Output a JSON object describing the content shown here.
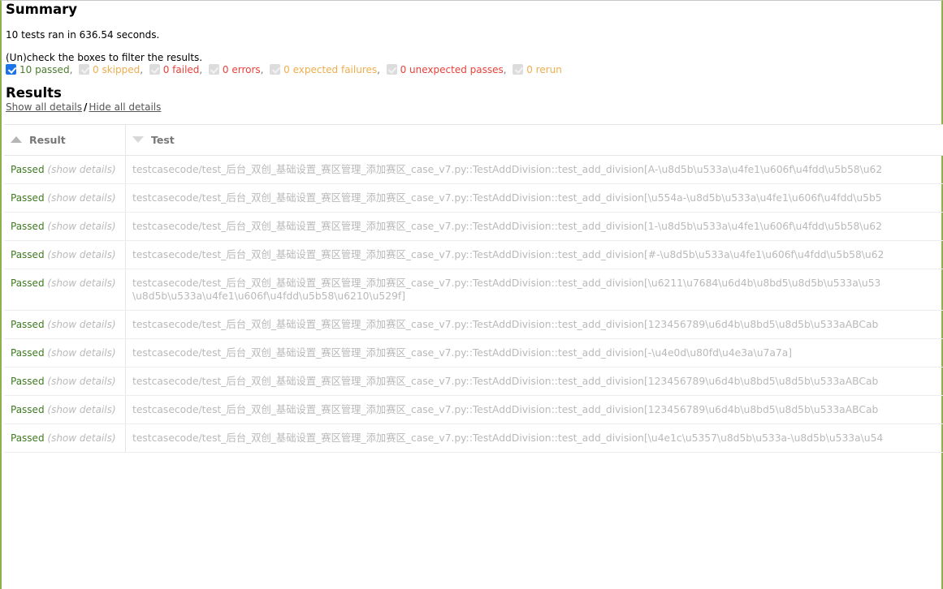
{
  "summary": {
    "title": "Summary",
    "run_line": "10 tests ran in 636.54 seconds.",
    "filter_hint": "(Un)check the boxes to filter the results.",
    "filters": [
      {
        "label": "10 passed",
        "checked": true,
        "color": "#4a7d2c",
        "name": "passed"
      },
      {
        "label": "0 skipped",
        "checked": false,
        "color": "#f0ad4e",
        "name": "skipped"
      },
      {
        "label": "0 failed",
        "checked": false,
        "color": "#e8413a",
        "name": "failed"
      },
      {
        "label": "0 errors",
        "checked": false,
        "color": "#e8413a",
        "name": "errors"
      },
      {
        "label": "0 expected failures",
        "checked": false,
        "color": "#f0ad4e",
        "name": "expected-failures"
      },
      {
        "label": "0 unexpected passes",
        "checked": false,
        "color": "#e8413a",
        "name": "unexpected-passes"
      },
      {
        "label": "0 rerun",
        "checked": false,
        "color": "#f0ad4e",
        "name": "rerun"
      }
    ],
    "separator": ","
  },
  "results": {
    "title": "Results",
    "show_all": "Show all details",
    "separator": "/",
    "hide_all": "Hide all details",
    "columns": [
      {
        "label": "Result",
        "sort": "asc"
      },
      {
        "label": "Test",
        "sort": "desc"
      }
    ],
    "rows": [
      {
        "result": "Passed",
        "detail_link": "(show details)",
        "test": "testcasecode/test_后台_双创_基础设置_赛区管理_添加赛区_case_v7.py::TestAddDivision::test_add_division[A-\\u8d5b\\u533a\\u4fe1\\u606f\\u4fdd\\u5b58\\u62",
        "test_line2": ""
      },
      {
        "result": "Passed",
        "detail_link": "(show details)",
        "test": "testcasecode/test_后台_双创_基础设置_赛区管理_添加赛区_case_v7.py::TestAddDivision::test_add_division[\\u554a-\\u8d5b\\u533a\\u4fe1\\u606f\\u4fdd\\u5b5",
        "test_line2": ""
      },
      {
        "result": "Passed",
        "detail_link": "(show details)",
        "test": "testcasecode/test_后台_双创_基础设置_赛区管理_添加赛区_case_v7.py::TestAddDivision::test_add_division[1-\\u8d5b\\u533a\\u4fe1\\u606f\\u4fdd\\u5b58\\u62",
        "test_line2": ""
      },
      {
        "result": "Passed",
        "detail_link": "(show details)",
        "test": "testcasecode/test_后台_双创_基础设置_赛区管理_添加赛区_case_v7.py::TestAddDivision::test_add_division[#-\\u8d5b\\u533a\\u4fe1\\u606f\\u4fdd\\u5b58\\u62",
        "test_line2": ""
      },
      {
        "result": "Passed",
        "detail_link": "(show details)",
        "test": "testcasecode/test_后台_双创_基础设置_赛区管理_添加赛区_case_v7.py::TestAddDivision::test_add_division[\\u6211\\u7684\\u6d4b\\u8bd5\\u8d5b\\u533a\\u53",
        "test_line2": "\\u8d5b\\u533a\\u4fe1\\u606f\\u4fdd\\u5b58\\u6210\\u529f]"
      },
      {
        "result": "Passed",
        "detail_link": "(show details)",
        "test": "testcasecode/test_后台_双创_基础设置_赛区管理_添加赛区_case_v7.py::TestAddDivision::test_add_division[123456789\\u6d4b\\u8bd5\\u8d5b\\u533aABCab",
        "test_line2": ""
      },
      {
        "result": "Passed",
        "detail_link": "(show details)",
        "test": "testcasecode/test_后台_双创_基础设置_赛区管理_添加赛区_case_v7.py::TestAddDivision::test_add_division[-\\u4e0d\\u80fd\\u4e3a\\u7a7a]",
        "test_line2": ""
      },
      {
        "result": "Passed",
        "detail_link": "(show details)",
        "test": "testcasecode/test_后台_双创_基础设置_赛区管理_添加赛区_case_v7.py::TestAddDivision::test_add_division[123456789\\u6d4b\\u8bd5\\u8d5b\\u533aABCab",
        "test_line2": ""
      },
      {
        "result": "Passed",
        "detail_link": "(show details)",
        "test": "testcasecode/test_后台_双创_基础设置_赛区管理_添加赛区_case_v7.py::TestAddDivision::test_add_division[123456789\\u6d4b\\u8bd5\\u8d5b\\u533aABCab",
        "test_line2": ""
      },
      {
        "result": "Passed",
        "detail_link": "(show details)",
        "test": "testcasecode/test_后台_双创_基础设置_赛区管理_添加赛区_case_v7.py::TestAddDivision::test_add_division[\\u4e1c\\u5357\\u8d5b\\u533a-\\u8d5b\\u533a\\u54",
        "test_line2": ""
      }
    ]
  }
}
